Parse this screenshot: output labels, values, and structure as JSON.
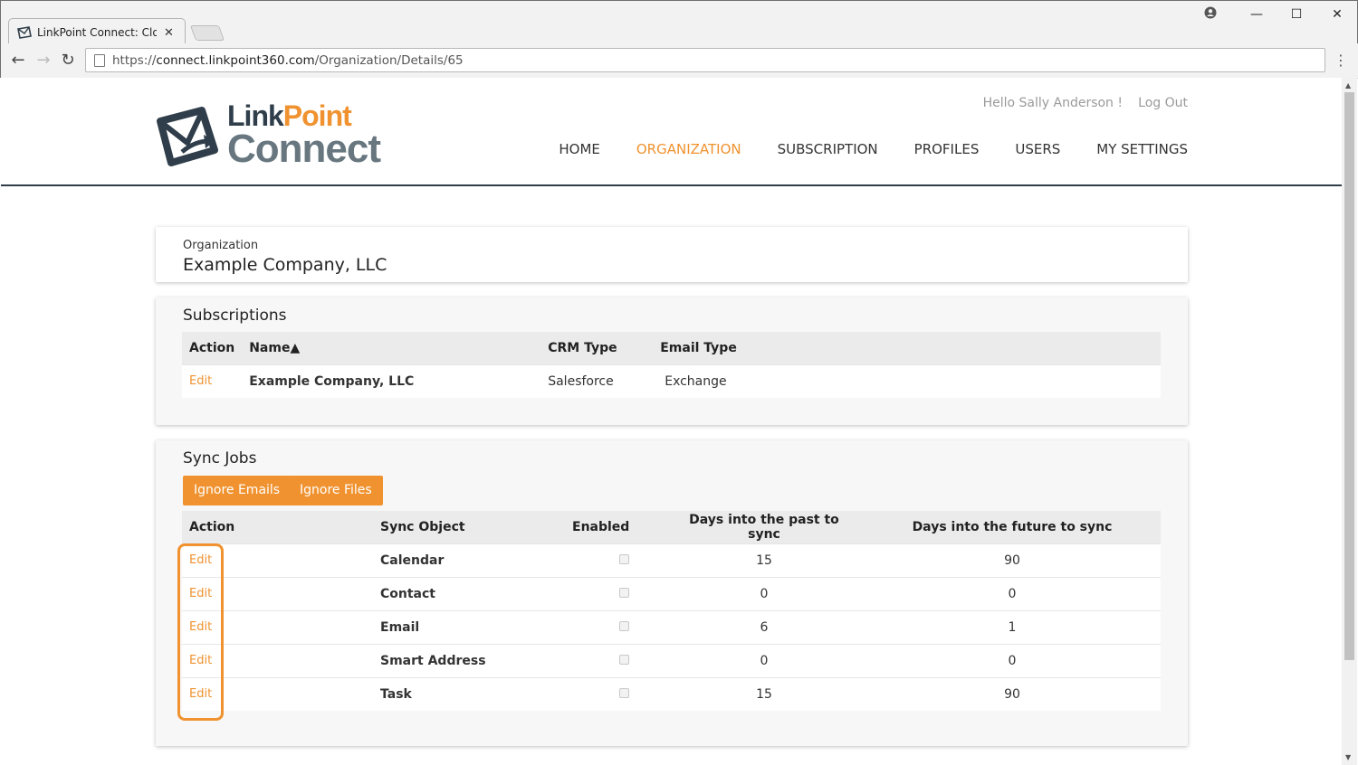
{
  "browser": {
    "tab_title": "LinkPoint Connect: Cloud",
    "url_scheme": "https://",
    "url_host": "connect.linkpoint360.com",
    "url_path": "/Organization/Details/65"
  },
  "header": {
    "logo_link": "Link",
    "logo_point": "Point",
    "logo_connect": "Connect",
    "greeting": "Hello Sally Anderson !",
    "logout": "Log Out",
    "nav": [
      "HOME",
      "ORGANIZATION",
      "SUBSCRIPTION",
      "PROFILES",
      "USERS",
      "MY SETTINGS"
    ],
    "active_nav": "ORGANIZATION"
  },
  "organization": {
    "label": "Organization",
    "name": "Example Company, LLC"
  },
  "subscriptions": {
    "title": "Subscriptions",
    "columns": [
      "Action",
      "Name▲",
      "CRM Type",
      "Email Type"
    ],
    "rows": [
      {
        "action": "Edit",
        "name": "Example Company, LLC",
        "crm": "Salesforce",
        "email": "Exchange"
      }
    ]
  },
  "sync_jobs": {
    "title": "Sync Jobs",
    "buttons": [
      "Ignore Emails",
      "Ignore Files"
    ],
    "columns": [
      "Action",
      "Sync Object",
      "Enabled",
      "Days into the past to sync",
      "Days into the future to sync"
    ],
    "rows": [
      {
        "action": "Edit",
        "object": "Calendar",
        "enabled": false,
        "past": "15",
        "future": "90"
      },
      {
        "action": "Edit",
        "object": "Contact",
        "enabled": false,
        "past": "0",
        "future": "0"
      },
      {
        "action": "Edit",
        "object": "Email",
        "enabled": false,
        "past": "6",
        "future": "1"
      },
      {
        "action": "Edit",
        "object": "Smart Address",
        "enabled": false,
        "past": "0",
        "future": "0"
      },
      {
        "action": "Edit",
        "object": "Task",
        "enabled": false,
        "past": "15",
        "future": "90"
      }
    ]
  },
  "colors": {
    "accent": "#f0922f",
    "navy": "#2f3e4a",
    "logo_gray": "#68777f"
  }
}
